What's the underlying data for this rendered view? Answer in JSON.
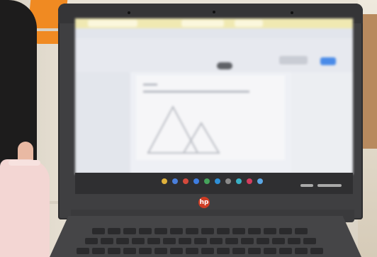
{
  "scene": {
    "description_type": "photo",
    "laptop_brand_logo": "hp-logo",
    "screen_content": "blurred",
    "colors": {
      "lid": "#3f3f41",
      "screen": "#eef0f5",
      "tabs_bar": "#f0e9b2",
      "accent_button": "#4a8be8",
      "hp_red": "#cf3c24",
      "orange_object": "#f08a22",
      "hair": "#1d1c1c",
      "mask": "#f3d6d3"
    },
    "shelf_icons": [
      {
        "name": "chrome-icon",
        "color": "#e0b13b"
      },
      {
        "name": "files-icon",
        "color": "#4a7fdc"
      },
      {
        "name": "app-red-icon",
        "color": "#d44a3c"
      },
      {
        "name": "app-blue-icon",
        "color": "#3e7de0"
      },
      {
        "name": "app-green-icon",
        "color": "#45a35b"
      },
      {
        "name": "app-blue2-icon",
        "color": "#2f8fd6"
      },
      {
        "name": "app-gray-icon",
        "color": "#8a8a8a"
      },
      {
        "name": "app-teal-icon",
        "color": "#3ab1c6"
      },
      {
        "name": "app-red2-icon",
        "color": "#d43d5e"
      },
      {
        "name": "app-lightblue-icon",
        "color": "#5aa7e6"
      }
    ]
  }
}
